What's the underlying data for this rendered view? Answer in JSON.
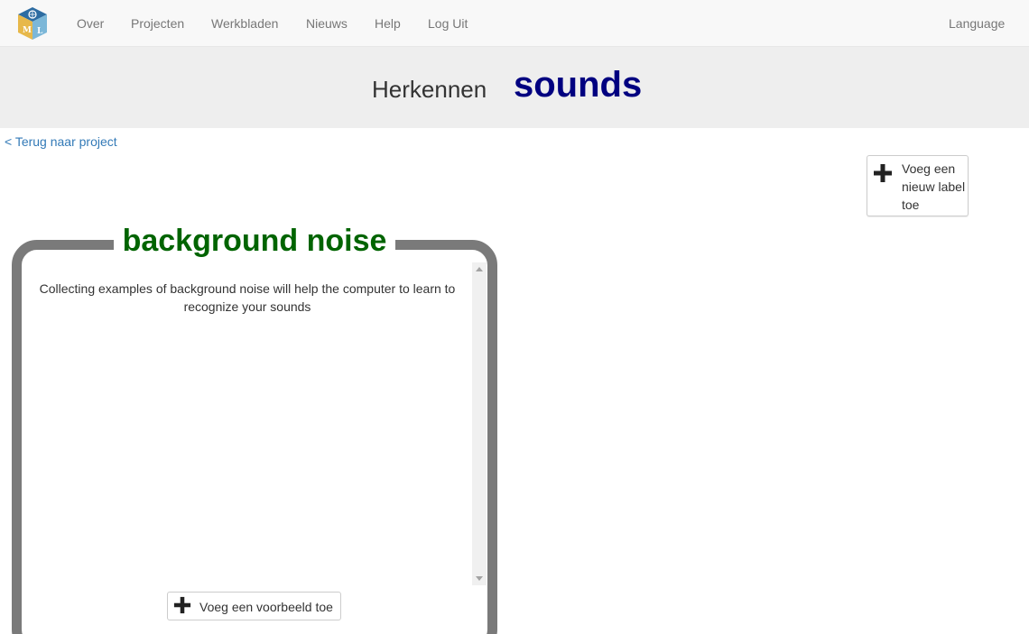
{
  "nav": {
    "logo_letters": "ML",
    "items": [
      {
        "label": "Over"
      },
      {
        "label": "Projecten"
      },
      {
        "label": "Werkbladen"
      },
      {
        "label": "Nieuws"
      },
      {
        "label": "Help"
      },
      {
        "label": "Log Uit"
      }
    ],
    "language_label": "Language"
  },
  "header": {
    "title": "Herkennen",
    "project_name": "sounds"
  },
  "back_link": "< Terug naar project",
  "add_label_button": {
    "label": "Voeg een nieuw label toe",
    "icon": "plus-icon"
  },
  "label_card": {
    "title": "background noise",
    "description": "Collecting examples of background noise will help the computer to learn to recognize your sounds",
    "add_example_label": "Voeg een voorbeeld toe",
    "icon": "plus-icon"
  },
  "colors": {
    "project_name": "#000080",
    "label_title": "#006400",
    "card_border": "#7a7a7a",
    "link": "#337ab7",
    "header_band": "#eeeeee",
    "navbar": "#f8f8f8"
  }
}
